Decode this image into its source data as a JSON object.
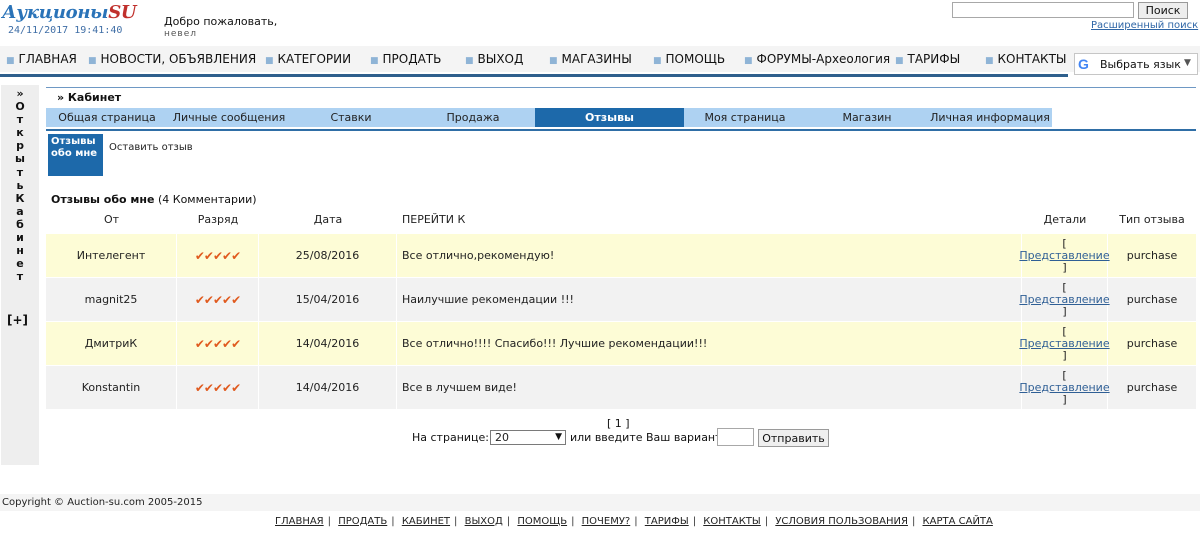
{
  "header": {
    "logo_main": "Аукционы",
    "logo_suffix": "SU",
    "datetime": "24/11/2017 19:41:40",
    "welcome": "Добро пожаловать,",
    "username": "невел",
    "search_placeholder": "",
    "search_button": "Поиск",
    "advanced_search": "Расширенный поиск"
  },
  "nav": {
    "items": [
      "ГЛАВНАЯ",
      "НОВОСТИ, ОБЪЯВЛЕНИЯ",
      "КАТЕГОРИИ",
      "ПРОДАТЬ",
      "ВЫХОД",
      "МАГАЗИНЫ",
      "ПОМОЩЬ",
      "ФОРУМЫ-Археология",
      "ТАРИФЫ",
      "КОНТАКТЫ"
    ],
    "translate": "Выбрать язык"
  },
  "side_tab": {
    "text": "»ОткрытьКабинет",
    "plus": "[+]"
  },
  "cabinet": {
    "title": "» Кабинет",
    "tabs": [
      "Общая страница",
      "Личные сообщения",
      "Ставки",
      "Продажа",
      "Отзывы",
      "Моя страница",
      "Магазин",
      "Личная информация"
    ],
    "subtabs": [
      "Отзывы обо мне",
      "Оставить отзыв"
    ]
  },
  "feedback": {
    "heading": "Отзывы обо мне",
    "count": "(4 Комментарии)",
    "columns": [
      "От",
      "Разряд",
      "Дата",
      "ПЕРЕЙТИ К",
      "Детали",
      "Тип отзыва"
    ],
    "rows": [
      {
        "from": "Интелегент",
        "rating": "✔✔✔✔✔",
        "date": "25/08/2016",
        "comment": "Все отлично,рекомендую!",
        "details": "Представление",
        "type": "purchase"
      },
      {
        "from": "magnit25",
        "rating": "✔✔✔✔✔",
        "date": "15/04/2016",
        "comment": "Наилучшие рекомендации !!!",
        "details": "Представление",
        "type": "purchase"
      },
      {
        "from": "ДмитриК",
        "rating": "✔✔✔✔✔",
        "date": "14/04/2016",
        "comment": "Все отлично!!!! Спасибо!!! Лучшие рекомендации!!!",
        "details": "Представление",
        "type": "purchase"
      },
      {
        "from": "Konstantin",
        "rating": "✔✔✔✔✔",
        "date": "14/04/2016",
        "comment": "Все в лучшем виде!",
        "details": "Представление",
        "type": "purchase"
      }
    ]
  },
  "pagination": {
    "pages": "[ 1 ]",
    "per_page_label": "На странице:",
    "per_page_value": "20",
    "custom_label": "или введите Ваш вариант:",
    "submit": "Отправить"
  },
  "footer": {
    "copyright": "Copyright © Auction-su.com 2005-2015",
    "links": [
      "ГЛАВНАЯ",
      "ПРОДАТЬ",
      "КАБИНЕТ",
      "ВЫХОД",
      "ПОМОЩЬ",
      "ПОЧЕМУ?",
      "ТАРИФЫ",
      "КОНТАКТЫ",
      "УСЛОВИЯ ПОЛЬЗОВАНИЯ",
      "КАРТА САЙТА"
    ]
  },
  "colors": {
    "accent": "#1d69aa",
    "tab_bg": "#aed2f2",
    "row_odd": "#fdfcd6",
    "row_even": "#f2f2f2",
    "stars": "#e05a1e"
  }
}
